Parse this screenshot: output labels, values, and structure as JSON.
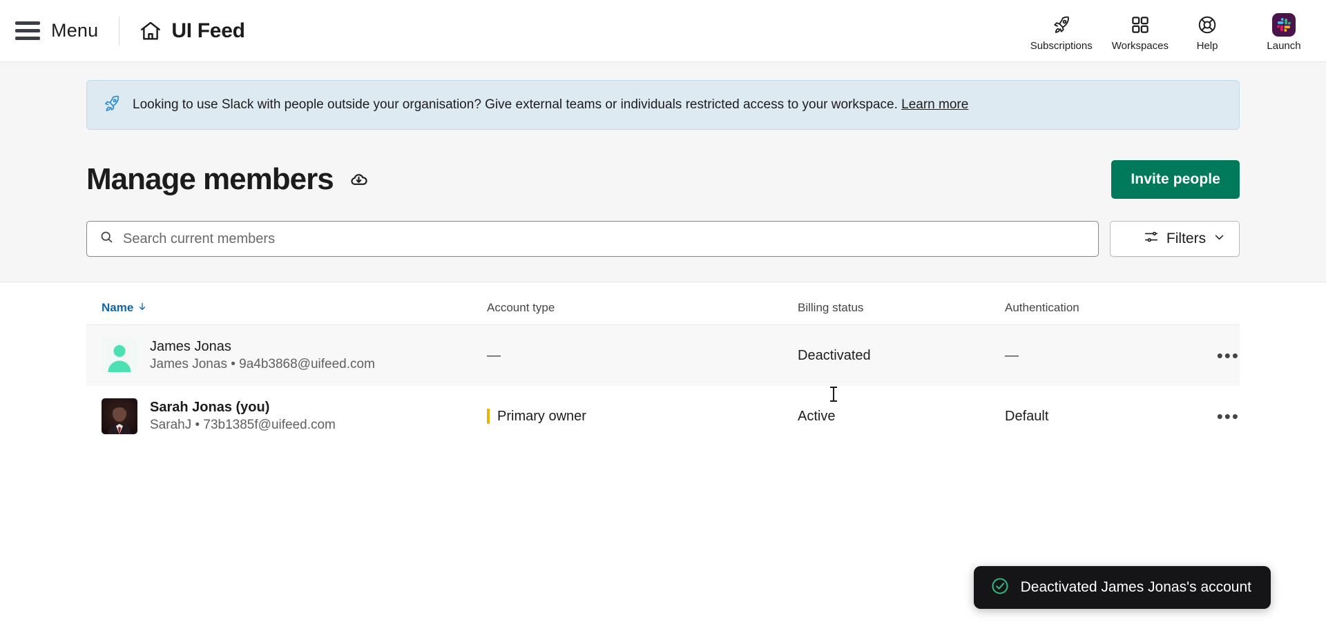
{
  "topbar": {
    "menu_label": "Menu",
    "app_title": "UI Feed",
    "hamburger_icon": "hamburger-menu-icon",
    "home_icon": "home-icon",
    "items": [
      {
        "label": "Subscriptions",
        "icon": "rocket-icon"
      },
      {
        "label": "Workspaces",
        "icon": "grid-squares-icon"
      },
      {
        "label": "Help",
        "icon": "lifebuoy-icon"
      },
      {
        "label": "Launch",
        "icon": "slack-logo-icon"
      }
    ]
  },
  "banner": {
    "icon": "rocket-icon",
    "text": "Looking to use Slack with people outside your organisation? Give external teams or individuals restricted access to your workspace.",
    "link_label": "Learn more",
    "background": "#ddeaf2",
    "border": "#bfd8e6"
  },
  "header": {
    "title": "Manage members",
    "download_icon": "cloud-download-icon",
    "invite_label": "Invite people",
    "invite_color": "#007a5a"
  },
  "search": {
    "icon": "search-icon",
    "value": "",
    "placeholder": "Search current members",
    "filters_label": "Filters",
    "filters_icon": "sliders-icon",
    "filters_chevron": "chevron-down-icon"
  },
  "table": {
    "columns": [
      {
        "key": "name",
        "label": "Name",
        "sorted": true,
        "sort_icon": "arrow-down-icon",
        "sort_color": "#1264a3"
      },
      {
        "key": "account_type",
        "label": "Account type",
        "sorted": false
      },
      {
        "key": "billing_status",
        "label": "Billing status",
        "sorted": false
      },
      {
        "key": "authentication",
        "label": "Authentication",
        "sorted": false
      }
    ],
    "rows": [
      {
        "avatar": "default-person-avatar",
        "name": "James Jonas",
        "subtitle": "James Jonas • 9a4b3868@uifeed.com",
        "name_bold": false,
        "account_type": "—",
        "account_type_is_owner": false,
        "billing_status": "Deactivated",
        "authentication": "—",
        "menu_icon": "overflow-menu-icon",
        "hovered": true
      },
      {
        "avatar": "photo-avatar",
        "name": "Sarah Jonas (you)",
        "subtitle": "SarahJ • 73b1385f@uifeed.com",
        "name_bold": true,
        "account_type": "Primary owner",
        "account_type_is_owner": true,
        "billing_status": "Active",
        "authentication": "Default",
        "menu_icon": "overflow-menu-icon",
        "hovered": false
      }
    ]
  },
  "toast": {
    "icon": "check-circle-icon",
    "message": "Deactivated James Jonas's account",
    "background": "#151517",
    "icon_color": "#2eb67d"
  }
}
